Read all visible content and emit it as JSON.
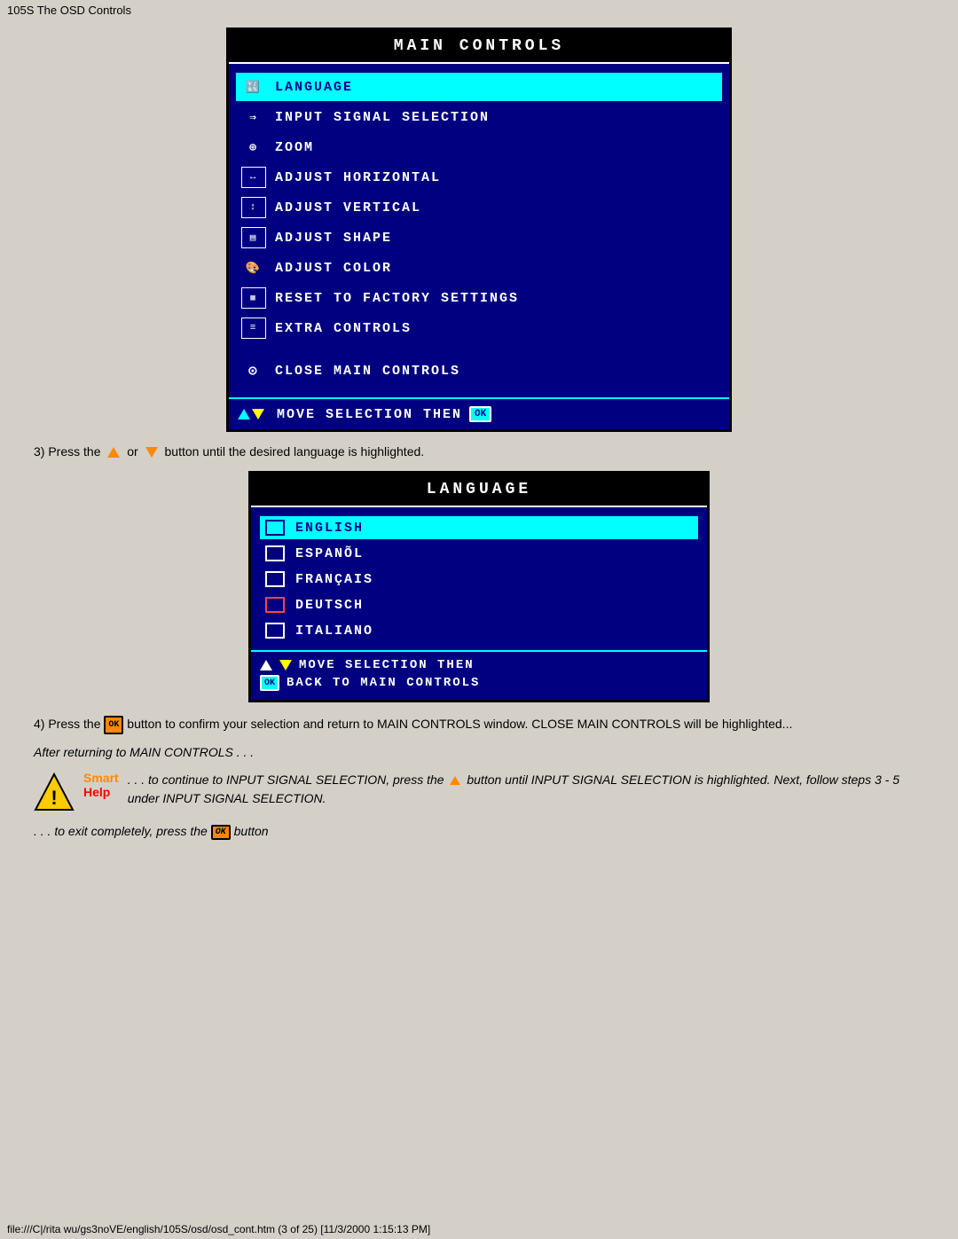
{
  "titleBar": {
    "text": "105S The OSD Controls"
  },
  "mainControls": {
    "header": "MAIN  CONTROLS",
    "items": [
      {
        "id": "language",
        "label": "LANGUAGE",
        "highlighted": true,
        "icon": "🔣"
      },
      {
        "id": "input-signal",
        "label": "INPUT  SIGNAL  SELECTION",
        "highlighted": false,
        "icon": "⇒"
      },
      {
        "id": "zoom",
        "label": "ZOOM",
        "highlighted": false,
        "icon": "⊕"
      },
      {
        "id": "adjust-horizontal",
        "label": "ADJUST  HORIZONTAL",
        "highlighted": false,
        "icon": "↔"
      },
      {
        "id": "adjust-vertical",
        "label": "ADJUST  VERTICAL",
        "highlighted": false,
        "icon": "↕"
      },
      {
        "id": "adjust-shape",
        "label": "ADJUST  SHAPE",
        "highlighted": false,
        "icon": "▤"
      },
      {
        "id": "adjust-color",
        "label": "ADJUST  COLOR",
        "highlighted": false,
        "icon": "🎨"
      },
      {
        "id": "reset-factory",
        "label": "RESET  TO  FACTORY  SETTINGS",
        "highlighted": false,
        "icon": "▦"
      },
      {
        "id": "extra-controls",
        "label": "EXTRA  CONTROLS",
        "highlighted": false,
        "icon": "≡"
      }
    ],
    "closeItem": "CLOSE  MAIN  CONTROLS",
    "footerText": "MOVE  SELECTION  THEN"
  },
  "instruction1": "3) Press the",
  "instruction1_mid": "or",
  "instruction1_end": "button until the desired language is highlighted.",
  "languageMenu": {
    "header": "LANGUAGE",
    "items": [
      {
        "id": "english",
        "label": "ENGLISH",
        "highlighted": true
      },
      {
        "id": "espanol",
        "label": "ESPANÕL",
        "highlighted": false
      },
      {
        "id": "francais",
        "label": "FRANÇAIS",
        "highlighted": false
      },
      {
        "id": "deutsch",
        "label": "DEUTSCH",
        "highlighted": false,
        "red": true
      },
      {
        "id": "italiano",
        "label": "ITALIANO",
        "highlighted": false
      }
    ],
    "footerLine1": "MOVE  SELECTION  THEN",
    "footerLine2": "BACK  TO  MAIN  CONTROLS"
  },
  "instruction2": "4) Press the",
  "instruction2_end": "button to confirm your selection and return to MAIN CONTROLS window. CLOSE MAIN CONTROLS will be highlighted...",
  "afterReturning": "After returning to MAIN CONTROLS . . .",
  "helpContent1": ". . . to continue to INPUT SIGNAL SELECTION, press the",
  "helpContent1_end": "button until INPUT SIGNAL SELECTION is highlighted. Next, follow steps 3 - 5 under INPUT SIGNAL SELECTION.",
  "helpContent2_start": ". . . to exit completely, press the",
  "helpContent2_end": "button",
  "smartLabel": "Smart",
  "helpLabel": "Help",
  "pageFooter": "file:///C|/rita wu/gs3noVE/english/105S/osd/osd_cont.htm (3 of 25) [11/3/2000 1:15:13 PM]"
}
